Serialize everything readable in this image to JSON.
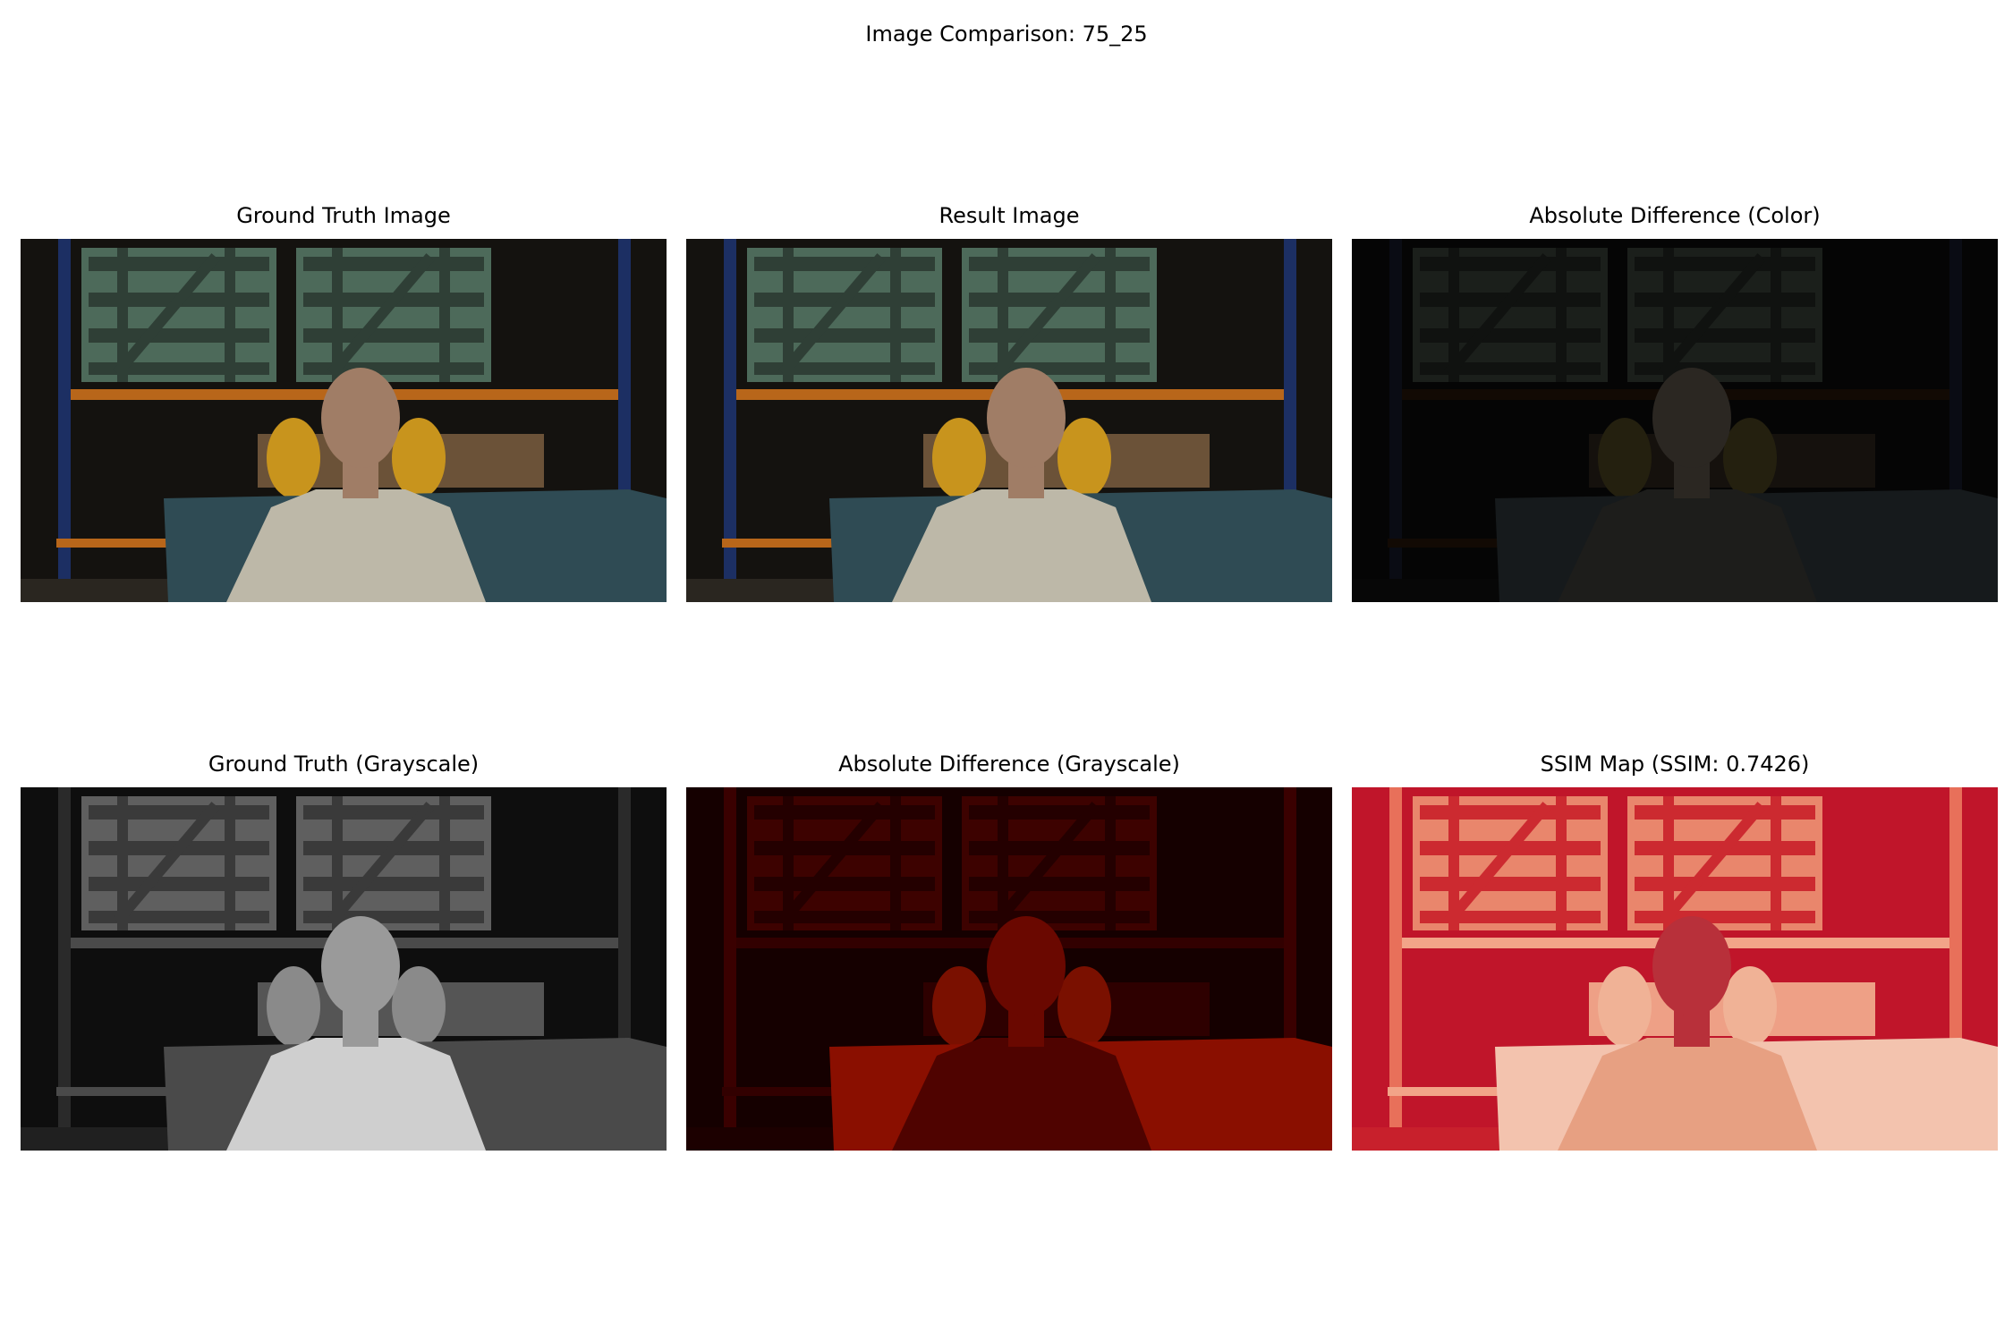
{
  "figure": {
    "title": "Image Comparison: 75_25"
  },
  "panels": [
    {
      "title": "Ground Truth Image",
      "style": "color",
      "image": "warehouse-man-scene"
    },
    {
      "title": "Result Image",
      "style": "color",
      "image": "warehouse-man-scene"
    },
    {
      "title": "Absolute Difference (Color)",
      "style": "diff-color",
      "image": "warehouse-man-scene"
    },
    {
      "title": "Ground Truth (Grayscale)",
      "style": "gray",
      "image": "warehouse-man-scene"
    },
    {
      "title": "Absolute Difference (Grayscale)",
      "style": "diff-gray",
      "image": "warehouse-man-scene"
    },
    {
      "title": "SSIM Map (SSIM: 0.7426)",
      "style": "ssim",
      "image": "warehouse-man-scene"
    }
  ],
  "palettes": {
    "color": {
      "bg": "#14120f",
      "rack": "#1c2f63",
      "beam": "#b8661a",
      "crate": "#4d6a5a",
      "crateDark": "#2f3f36",
      "table": "#2f4b54",
      "hose": "#c8941d",
      "shirt": "#bdb8a8",
      "skin": "#a07d66",
      "chair": "#6b5238",
      "floor": "#2a2620"
    },
    "diff-color": {
      "bg": "#050505",
      "rack": "#0a0c14",
      "beam": "#120a04",
      "crate": "#1b1f1b",
      "crateDark": "#101210",
      "table": "#161a1c",
      "hose": "#24200f",
      "shirt": "#1d1d1b",
      "skin": "#2b2722",
      "chair": "#15110d",
      "floor": "#070707"
    },
    "gray": {
      "bg": "#0e0e0e",
      "rack": "#2a2a2a",
      "beam": "#4a4a4a",
      "crate": "#5f5f5f",
      "crateDark": "#3a3a3a",
      "table": "#4a4a4a",
      "hose": "#8a8a8a",
      "shirt": "#cfcfcf",
      "skin": "#9a9a9a",
      "chair": "#555555",
      "floor": "#202020"
    },
    "diff-gray": {
      "bg": "#150000",
      "rack": "#3a0000",
      "beam": "#320000",
      "crate": "#3d0200",
      "crateDark": "#240000",
      "table": "#8a0f00",
      "hose": "#7a1000",
      "shirt": "#4f0300",
      "skin": "#6a0800",
      "chair": "#2e0000",
      "floor": "#1c0000"
    },
    "ssim": {
      "bg": "#c0152a",
      "rack": "#e8705a",
      "beam": "#f2a488",
      "crate": "#e9866c",
      "crateDark": "#cc2a30",
      "table": "#f3c3ae",
      "hose": "#f0b296",
      "shirt": "#e7a082",
      "skin": "#b8303a",
      "chair": "#eea086",
      "floor": "#c8202c"
    }
  }
}
